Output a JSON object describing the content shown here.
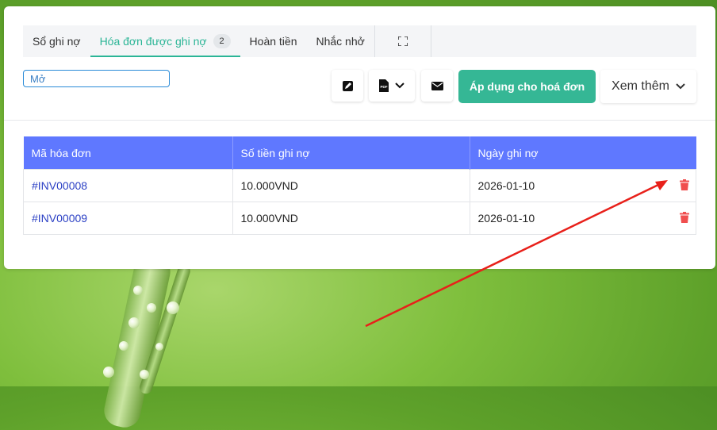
{
  "tabs": [
    {
      "label": "Sổ ghi nợ",
      "active": false
    },
    {
      "label": "Hóa đơn được ghi nợ",
      "active": true,
      "badge": "2"
    },
    {
      "label": "Hoàn tiền",
      "active": false
    },
    {
      "label": "Nhắc nhở",
      "active": false
    }
  ],
  "filter": {
    "value": "Mở"
  },
  "toolbar": {
    "edit_icon": "edit-icon",
    "pdf_icon": "pdf-icon",
    "mail_icon": "mail-icon",
    "apply_label": "Áp dụng cho hoá đơn",
    "more_label": "Xem thêm"
  },
  "table": {
    "headers": [
      "Mã hóa đơn",
      "Số tiền ghi nợ",
      "Ngày ghi nợ"
    ],
    "rows": [
      {
        "invoice": "#INV00008",
        "amount": "10.000VND",
        "date": "2026-01-10"
      },
      {
        "invoice": "#INV00009",
        "amount": "10.000VND",
        "date": "2026-01-10"
      }
    ]
  },
  "colors": {
    "accent": "#35b795",
    "header_bg": "#5f78ff",
    "trash": "#f04e4e",
    "annotation_arrow": "#e8201a"
  }
}
